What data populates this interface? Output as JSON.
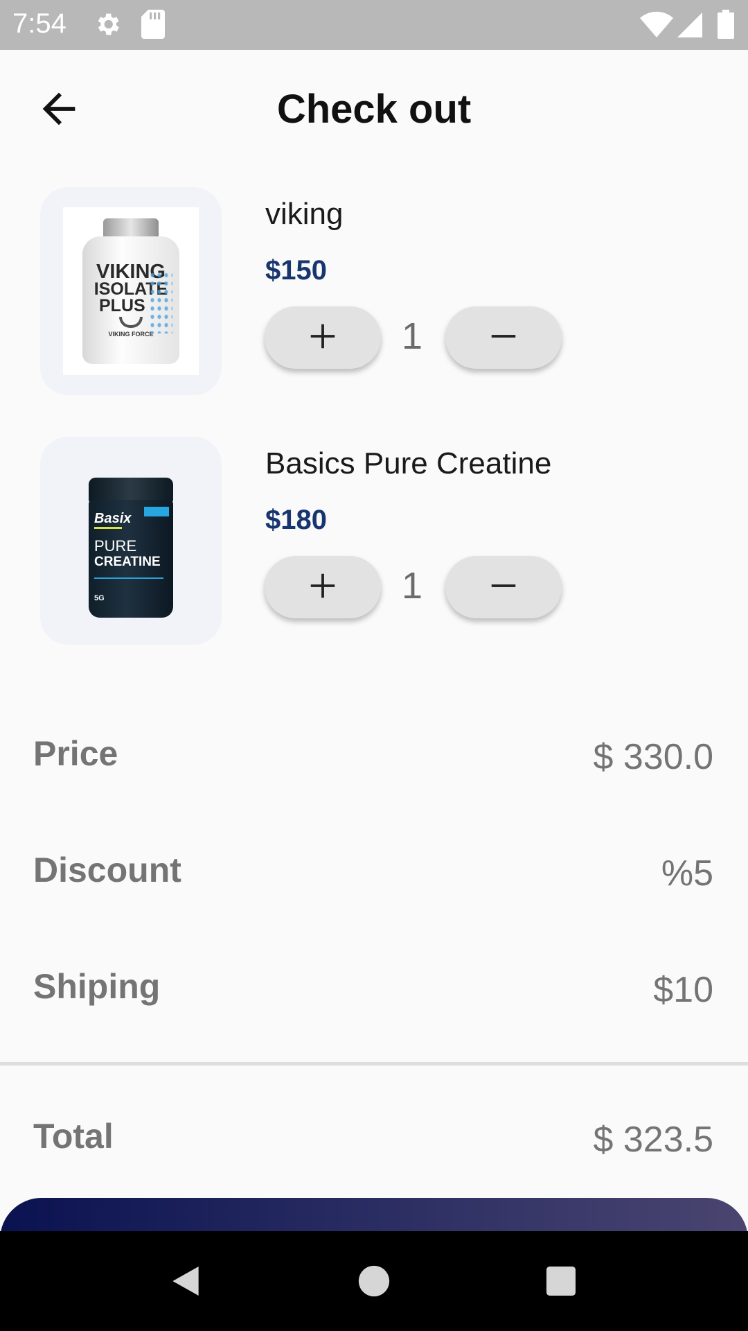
{
  "status_bar": {
    "time": "7:54",
    "icons": [
      "gear-icon",
      "sd-card-icon",
      "wifi-icon",
      "signal-icon",
      "battery-icon"
    ]
  },
  "header": {
    "title": "Check out",
    "back_icon": "arrow-left-icon"
  },
  "cart": {
    "items": [
      {
        "name": "viking",
        "price": "$150",
        "quantity": "1",
        "image_label": [
          "VIKING",
          "ISOLATE",
          "PLUS"
        ],
        "image_brand": "VIKING FORCE"
      },
      {
        "name": "Basics Pure Creatine",
        "price": "$180",
        "quantity": "1",
        "image_label": [
          "Basix",
          "PURE",
          "CREATINE"
        ],
        "image_brand": "5G"
      }
    ]
  },
  "summary": {
    "price_label": "Price",
    "price_value": "$ 330.0",
    "discount_label": "Discount",
    "discount_value": "%5",
    "shipping_label": "Shiping",
    "shipping_value": "$10",
    "total_label": "Total",
    "total_value": "$ 323.5"
  },
  "nav": {
    "icons": [
      "back-triangle-icon",
      "home-circle-icon",
      "recents-square-icon"
    ]
  },
  "colors": {
    "status_bar": "#b8b8b8",
    "price_accent": "#17356e",
    "checkout_gradient_start": "#0a1250",
    "checkout_gradient_end": "#4a4570"
  }
}
